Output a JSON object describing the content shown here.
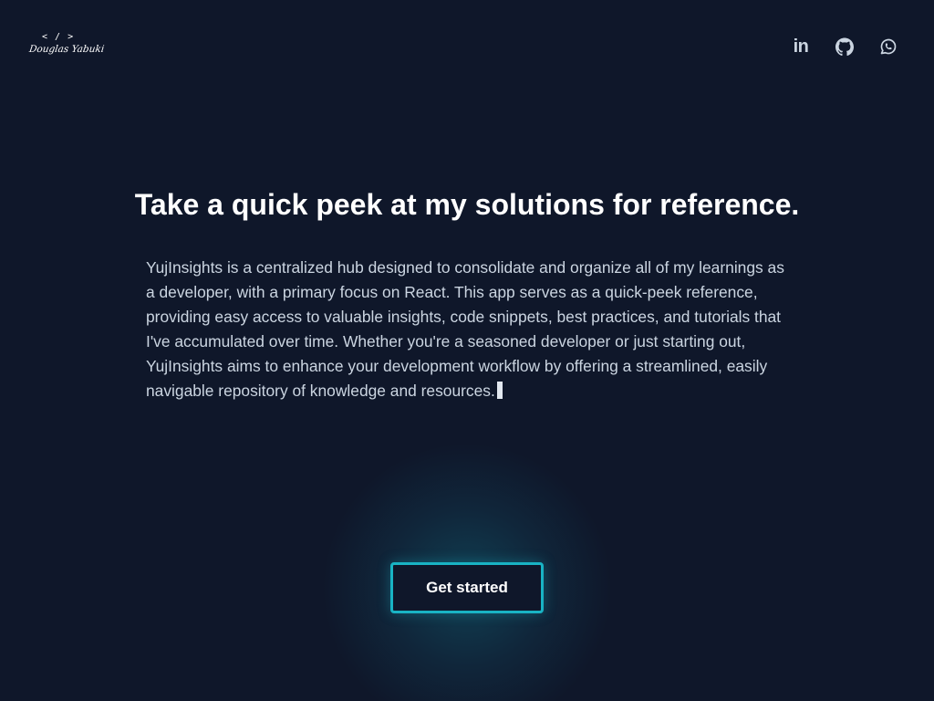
{
  "header": {
    "logo": {
      "mark": "< / >",
      "name": "Douglas Yabuki"
    },
    "socials": [
      {
        "label": "in",
        "icon": "linkedin-icon"
      },
      {
        "icon": "github-icon"
      },
      {
        "icon": "whatsapp-icon"
      }
    ]
  },
  "hero": {
    "title": "Take a quick peek at my solutions for reference.",
    "description": "YujInsights is a centralized hub designed to consolidate and organize all of my learnings as a developer, with a primary focus on React. This app serves as a quick-peek reference, providing easy access to valuable insights, code snippets, best practices, and tutorials that I've accumulated over time. Whether you're a seasoned developer or just starting out, YujInsights aims to enhance your development workflow by offering a streamlined, easily navigable repository of knowledge and resources.",
    "cta_label": "Get started"
  },
  "colors": {
    "background": "#0f172a",
    "accent": "#19b3c4",
    "text": "#cbd5e1"
  }
}
